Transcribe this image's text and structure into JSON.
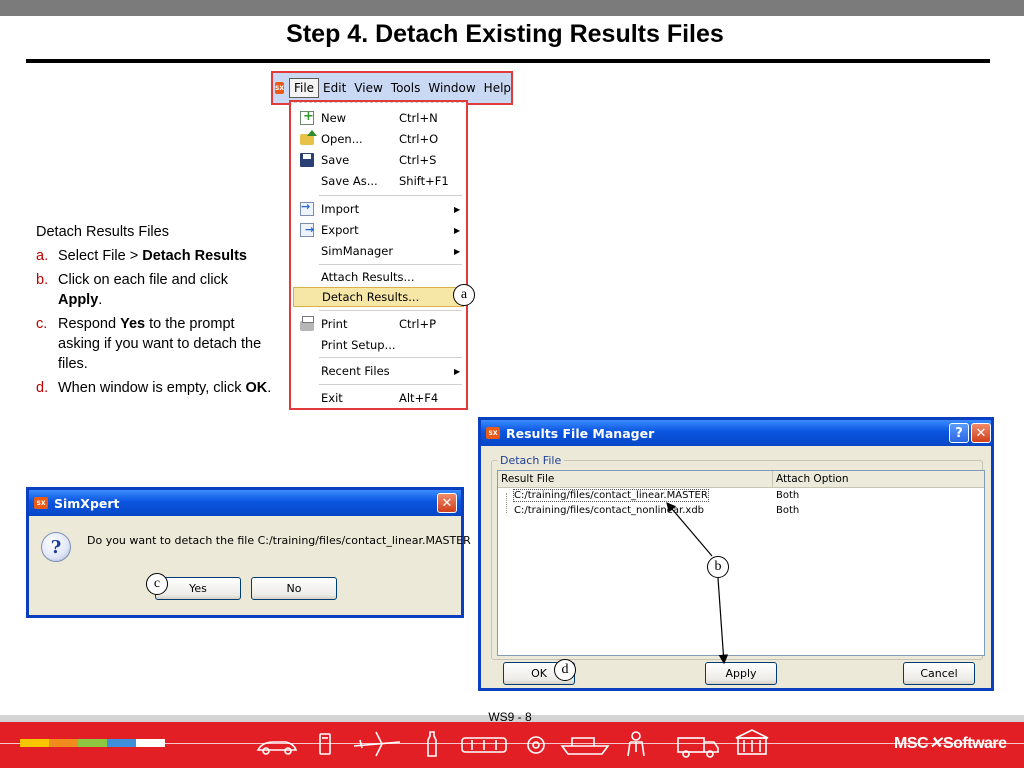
{
  "slide": {
    "title": "Step 4. Detach Existing Results Files",
    "page_number": "WS9 - 8"
  },
  "instructions": {
    "intro": "Detach Results Files",
    "steps": [
      {
        "letter": "a.",
        "parts": [
          "Select File > ",
          "Detach Results",
          ""
        ]
      },
      {
        "letter": "b.",
        "parts": [
          "Click on each file and click ",
          "Apply",
          "."
        ]
      },
      {
        "letter": "c.",
        "parts": [
          "Respond ",
          "Yes",
          " to the prompt asking if you want to detach the files."
        ]
      },
      {
        "letter": "d.",
        "parts": [
          "When window is empty, click ",
          "OK",
          "."
        ]
      }
    ]
  },
  "app_badge": "SX",
  "menubar": [
    "File",
    "Edit",
    "View",
    "Tools",
    "Window",
    "Help"
  ],
  "file_menu": [
    {
      "icon": "new-icon",
      "label": "New",
      "shortcut": "Ctrl+N"
    },
    {
      "icon": "open-icon",
      "label": "Open...",
      "shortcut": "Ctrl+O"
    },
    {
      "icon": "save-icon",
      "label": "Save",
      "shortcut": "Ctrl+S"
    },
    {
      "icon": "",
      "label": "Save As...",
      "shortcut": "Shift+F1"
    },
    {
      "icon": "import-icon",
      "label": "Import",
      "submenu": true
    },
    {
      "icon": "export-icon",
      "label": "Export",
      "submenu": true
    },
    {
      "icon": "",
      "label": "SimManager",
      "submenu": true
    },
    {
      "icon": "",
      "label": "Attach Results..."
    },
    {
      "icon": "",
      "label": "Detach Results...",
      "highlighted": true
    },
    {
      "icon": "print-icon",
      "label": "Print",
      "shortcut": "Ctrl+P"
    },
    {
      "icon": "",
      "label": "Print Setup..."
    },
    {
      "icon": "",
      "label": "Recent Files",
      "submenu": true
    },
    {
      "icon": "",
      "label": "Exit",
      "shortcut": "Alt+F4"
    }
  ],
  "callouts": {
    "a": "a",
    "b": "b",
    "c": "c",
    "d": "d"
  },
  "results_file_manager": {
    "title": "Results File Manager",
    "group_label": "Detach File",
    "columns": [
      "Result File",
      "Attach Option"
    ],
    "rows": [
      {
        "file": "C:/training/files/contact_linear.MASTER",
        "option": "Both",
        "selected": true
      },
      {
        "file": "C:/training/files/contact_nonlinear.xdb",
        "option": "Both"
      }
    ],
    "ok_label": "OK",
    "apply_label": "Apply",
    "cancel_label": "Cancel"
  },
  "prompt": {
    "title": "SimXpert",
    "message": "Do you want to detach the file C:/training/files/contact_linear.MASTER",
    "yes_label": "Yes",
    "no_label": "No"
  },
  "footer": {
    "brand": "MSC",
    "brand_suffix": "Software",
    "swatch_colors": [
      "#f7c600",
      "#f08c1e",
      "#8dc63f",
      "#3c8fd8",
      "#ffffff"
    ]
  },
  "colors": {
    "accent_red": "#e31f26",
    "xp_title_blue": "#0a55df",
    "menu_highlight": "#f6e7a6",
    "step_letter": "#c00000"
  }
}
